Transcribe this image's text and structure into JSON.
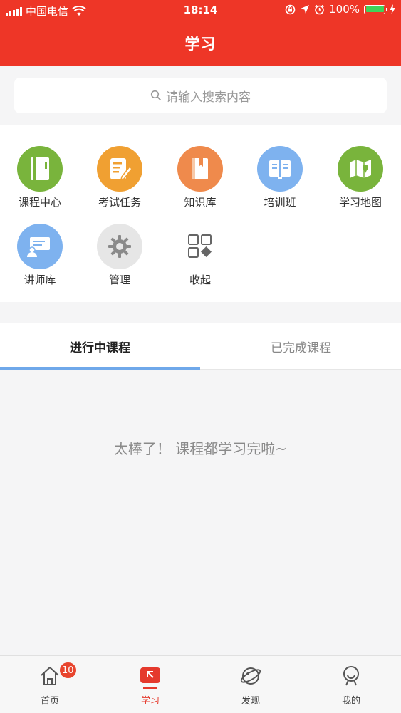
{
  "status": {
    "carrier": "中国电信",
    "time": "18:14",
    "battery": "100%"
  },
  "header": {
    "title": "学习"
  },
  "search": {
    "placeholder": "请输入搜索内容"
  },
  "grid": {
    "items": [
      {
        "label": "课程中心",
        "icon": "notebook-icon",
        "color": "#79b43c"
      },
      {
        "label": "考试任务",
        "icon": "exam-edit-icon",
        "color": "#f0a032"
      },
      {
        "label": "知识库",
        "icon": "book-icon",
        "color": "#ef8a4c"
      },
      {
        "label": "培训班",
        "icon": "training-board-icon",
        "color": "#7eb2ef"
      },
      {
        "label": "学习地图",
        "icon": "map-icon",
        "color": "#79b43c"
      },
      {
        "label": "讲师库",
        "icon": "lecturer-icon",
        "color": "#7eb2ef"
      },
      {
        "label": "管理",
        "icon": "gear-icon",
        "color": "#e6e6e6"
      },
      {
        "label": "收起",
        "icon": "collapse-grid-icon",
        "color": "#ffffff"
      }
    ]
  },
  "tabs": {
    "active": "进行中课程",
    "inactive": "已完成课程",
    "accent": "#6fa8ea"
  },
  "empty_message": "太棒了！ 课程都学习完啦~",
  "nav": {
    "items": [
      {
        "label": "首页",
        "icon": "home-icon",
        "badge": "10"
      },
      {
        "label": "学习",
        "icon": "study-icon"
      },
      {
        "label": "发现",
        "icon": "planet-icon"
      },
      {
        "label": "我的",
        "icon": "profile-icon"
      }
    ],
    "active_color": "#e53a2d"
  },
  "brand_color": "#ee3627"
}
